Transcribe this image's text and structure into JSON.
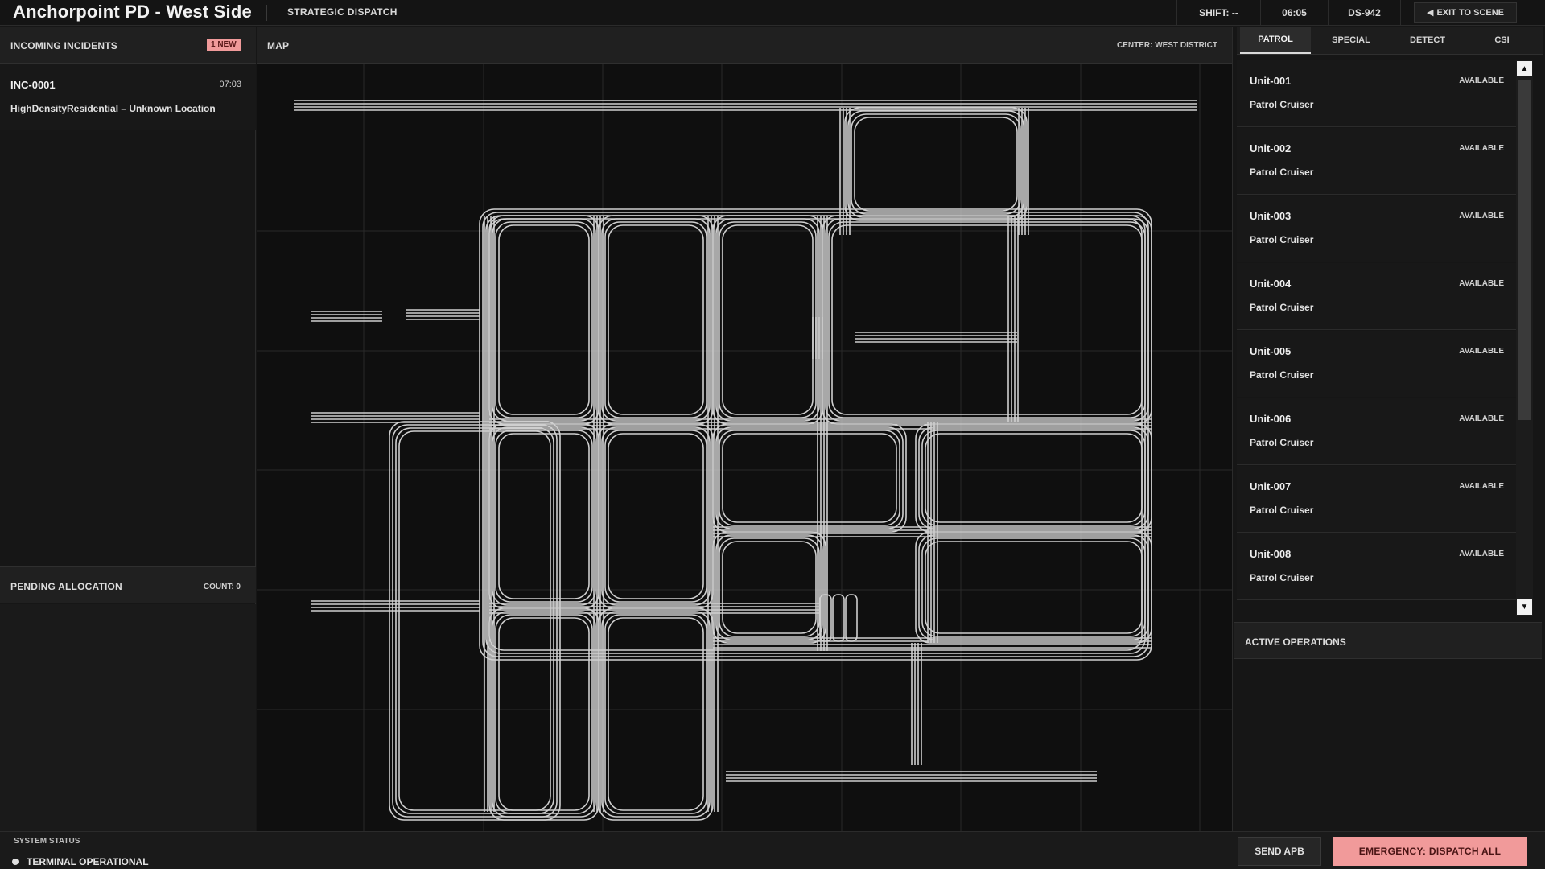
{
  "header": {
    "title": "Anchorpoint PD - West Side",
    "mode": "STRATEGIC DISPATCH",
    "shift": "SHIFT: --",
    "clock": "06:05",
    "station_id": "DS-942",
    "exit_label": "EXIT TO SCENE",
    "exit_icon": "triangle-left-icon"
  },
  "incidents": {
    "title": "INCOMING INCIDENTS",
    "badge": "1 NEW",
    "items": [
      {
        "id": "INC-0001",
        "time": "07:03",
        "location": "HighDensityResidential – Unknown Location"
      }
    ]
  },
  "pending": {
    "title": "PENDING ALLOCATION",
    "count": "COUNT: 0"
  },
  "map": {
    "title": "MAP",
    "center": "CENTER: WEST DISTRICT"
  },
  "tabs": [
    "PATROL",
    "SPECIAL",
    "DETECT",
    "CSI"
  ],
  "active_tab": "PATROL",
  "units": [
    {
      "name": "Unit-001",
      "status": "AVAILABLE",
      "type": "Patrol Cruiser"
    },
    {
      "name": "Unit-002",
      "status": "AVAILABLE",
      "type": "Patrol Cruiser"
    },
    {
      "name": "Unit-003",
      "status": "AVAILABLE",
      "type": "Patrol Cruiser"
    },
    {
      "name": "Unit-004",
      "status": "AVAILABLE",
      "type": "Patrol Cruiser"
    },
    {
      "name": "Unit-005",
      "status": "AVAILABLE",
      "type": "Patrol Cruiser"
    },
    {
      "name": "Unit-006",
      "status": "AVAILABLE",
      "type": "Patrol Cruiser"
    },
    {
      "name": "Unit-007",
      "status": "AVAILABLE",
      "type": "Patrol Cruiser"
    },
    {
      "name": "Unit-008",
      "status": "AVAILABLE",
      "type": "Patrol Cruiser"
    }
  ],
  "scroll": {
    "up_icon": "triangle-up-icon",
    "down_icon": "triangle-down-icon"
  },
  "operations": {
    "title": "ACTIVE OPERATIONS"
  },
  "footer": {
    "system_label": "SYSTEM STATUS",
    "system_status": "TERMINAL OPERATIONAL",
    "apb_label": "SEND APB",
    "emergency_label": "EMERGENCY: DISPATCH ALL"
  },
  "colors": {
    "accent": "#f19a9a",
    "road": "#cfcfcf",
    "background": "#0f0f0f"
  }
}
